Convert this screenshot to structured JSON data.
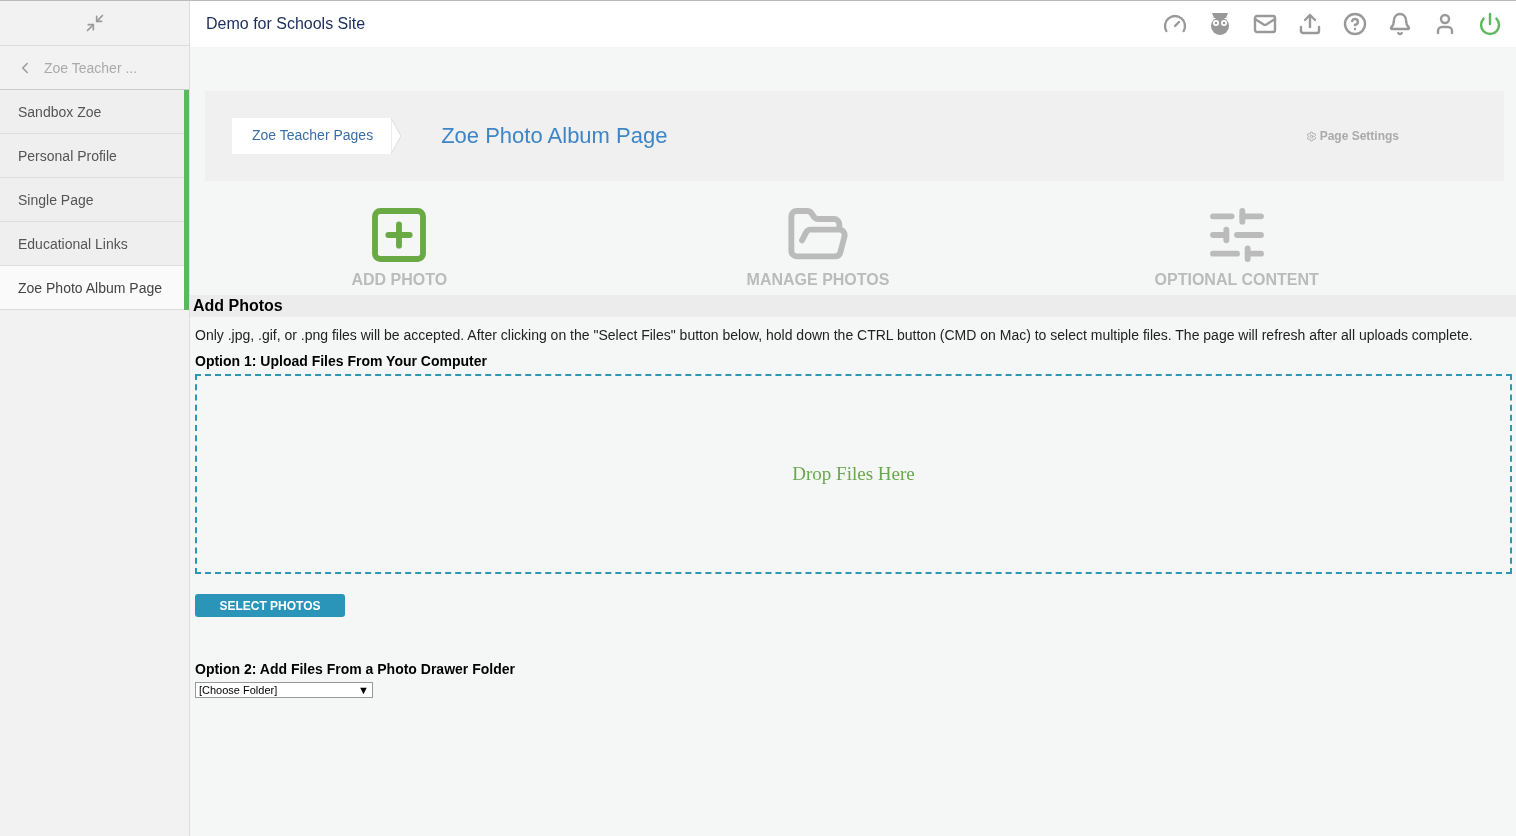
{
  "site_title": "Demo for Schools Site",
  "sidebar": {
    "back_label": "Zoe Teacher ...",
    "items": [
      {
        "label": "Sandbox Zoe",
        "selected": false
      },
      {
        "label": "Personal Profile",
        "selected": false
      },
      {
        "label": "Single Page",
        "selected": false
      },
      {
        "label": "Educational Links",
        "selected": false
      },
      {
        "label": "Zoe Photo Album Page",
        "selected": true
      }
    ]
  },
  "breadcrumb": "Zoe Teacher Pages",
  "page_title": "Zoe Photo Album Page",
  "page_settings": "Page Settings",
  "actions": [
    {
      "label": "ADD PHOTO",
      "kind": "add",
      "selected": true
    },
    {
      "label": "MANAGE PHOTOS",
      "kind": "folder",
      "selected": false
    },
    {
      "label": "OPTIONAL CONTENT",
      "kind": "sliders",
      "selected": false
    }
  ],
  "section_title": "Add Photos",
  "instructions": "Only .jpg, .gif, or .png files will be accepted. After clicking on the \"Select Files\" button below, hold down the CTRL button (CMD on Mac) to select multiple files. The page will refresh after all uploads complete.",
  "option1": "Option 1: Upload Files From Your Computer",
  "drop_text": "Drop Files Here",
  "select_button": "SELECT PHOTOS",
  "option2": "Option 2: Add Files From a Photo Drawer Folder",
  "folder_select": {
    "value": "[Choose Folder]",
    "arrow": "▼"
  }
}
